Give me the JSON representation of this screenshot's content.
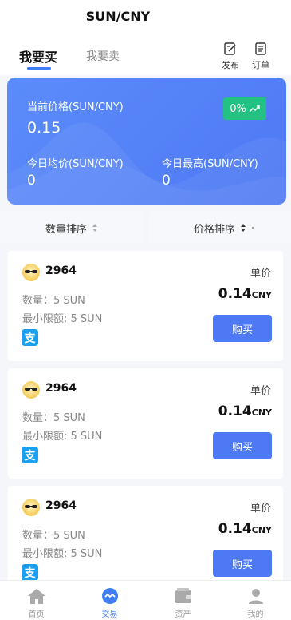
{
  "header": {
    "title": "SUN/CNY",
    "tabs": [
      {
        "label": "我要买",
        "active": true
      },
      {
        "label": "我要卖",
        "active": false
      }
    ],
    "actions": [
      {
        "label": "发布",
        "icon": "edit-icon"
      },
      {
        "label": "订单",
        "icon": "order-list-icon"
      }
    ]
  },
  "summary": {
    "current_price_label": "当前价格(SUN/CNY)",
    "current_price": "0.15",
    "change_badge": "0%",
    "avg_label": "今日均价(SUN/CNY)",
    "avg_value": "0",
    "high_label": "今日最高(SUN/CNY)",
    "high_value": "0"
  },
  "sort": {
    "quantity_label": "数量排序",
    "price_label": "价格排序"
  },
  "listings": [
    {
      "user": "2964",
      "qty": "数量：5 SUN",
      "min_limit": "最小限额: 5 SUN",
      "unit_label": "单价",
      "price": "0.14",
      "currency": "CNY",
      "pay_icon": "alipay-icon",
      "button": "购买"
    },
    {
      "user": "2964",
      "qty": "数量：5 SUN",
      "min_limit": "最小限额: 5 SUN",
      "unit_label": "单价",
      "price": "0.14",
      "currency": "CNY",
      "pay_icon": "alipay-icon",
      "button": "购买"
    },
    {
      "user": "2964",
      "qty": "数量：5 SUN",
      "min_limit": "最小限额: 5 SUN",
      "unit_label": "单价",
      "price": "0.14",
      "currency": "CNY",
      "pay_icon": "alipay-icon",
      "button": "购买"
    }
  ],
  "nav": [
    {
      "label": "首页",
      "icon": "home-icon",
      "active": false
    },
    {
      "label": "交易",
      "icon": "trade-icon",
      "active": true
    },
    {
      "label": "资产",
      "icon": "wallet-icon",
      "active": false
    },
    {
      "label": "我的",
      "icon": "user-icon",
      "active": false
    }
  ],
  "colors": {
    "accent": "#3f7cf5",
    "hero": "#4d78f3",
    "badge_green": "#23c182",
    "alipay": "#1aa0ee"
  }
}
